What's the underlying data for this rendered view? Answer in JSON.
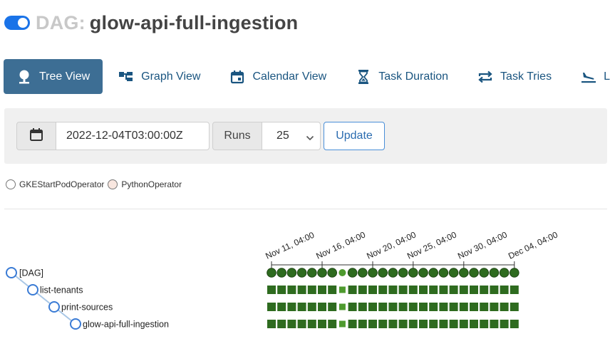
{
  "header": {
    "prefix": "DAG:",
    "dag_id": "glow-api-full-ingestion",
    "toggle_on": true,
    "accent": "#1a73e8"
  },
  "tabs": [
    {
      "label": "Tree View",
      "icon": "tree-icon",
      "active": true
    },
    {
      "label": "Graph View",
      "icon": "graph-icon",
      "active": false
    },
    {
      "label": "Calendar View",
      "icon": "calendar-icon",
      "active": false
    },
    {
      "label": "Task Duration",
      "icon": "hourglass-icon",
      "active": false
    },
    {
      "label": "Task Tries",
      "icon": "retry-icon",
      "active": false
    },
    {
      "label": "Lan",
      "icon": "landing-icon",
      "active": false
    }
  ],
  "controls": {
    "date_value": "2022-12-04T03:00:00Z",
    "runs_label": "Runs",
    "runs_value": "25",
    "update_label": "Update"
  },
  "legend": [
    {
      "label": "GKEStartPodOperator",
      "color": "#ffffff"
    },
    {
      "label": "PythonOperator",
      "color": "#f9e7e0"
    }
  ],
  "tree": {
    "nodes": [
      "[DAG]",
      "list-tenants",
      "print-sources",
      "glow-api-full-ingestion"
    ],
    "date_labels": [
      "Nov 11, 04:00",
      "Nov 16, 04:00",
      "Nov 20, 04:00",
      "Nov 25, 04:00",
      "Nov 30, 04:00",
      "Dec 04, 04:00"
    ],
    "run_count": 25,
    "highlight_run_index": 7,
    "success_color": "#2e6b1f",
    "success_light_color": "#4e9a2e",
    "active_tab_color": "#3d6e94"
  }
}
